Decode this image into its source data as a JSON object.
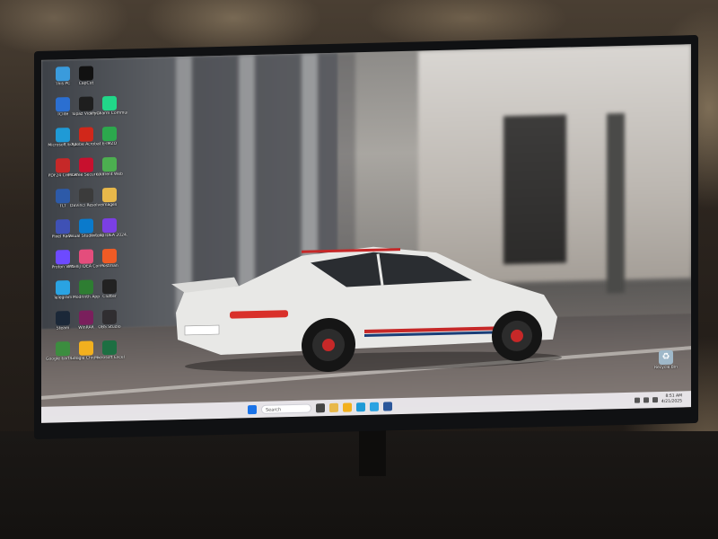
{
  "desktop": {
    "icons": [
      {
        "label": "This PC",
        "icon": "computer-icon",
        "color": "#3a9bdc"
      },
      {
        "label": "CapCut",
        "icon": "capcut-icon",
        "color": "#111111"
      },
      {
        "label": "TClite",
        "icon": "tclite-icon",
        "color": "#2b6fd1"
      },
      {
        "label": "Topaz Video AI",
        "icon": "topaz-icon",
        "color": "#1e1e1e"
      },
      {
        "label": "PyCharm Commun...",
        "icon": "pycharm-icon",
        "color": "#21d789"
      },
      {
        "label": "Microsoft Edge",
        "icon": "edge-icon",
        "color": "#1f9ad6"
      },
      {
        "label": "Adobe Acrobat",
        "icon": "acrobat-icon",
        "color": "#d1271a"
      },
      {
        "label": "E-IMZO",
        "icon": "eimzo-icon",
        "color": "#2ca84d"
      },
      {
        "label": "PDF24 Creator",
        "icon": "pdf24-icon",
        "color": "#c62828"
      },
      {
        "label": "McAfee Security Sc...",
        "icon": "mcafee-icon",
        "color": "#c8102e"
      },
      {
        "label": "uTorrent Web",
        "icon": "utorrent-icon",
        "color": "#4caf50"
      },
      {
        "label": "TLT",
        "icon": "tlt-icon",
        "color": "#2d5aa8"
      },
      {
        "label": "DaVinci Resolve",
        "icon": "davinci-icon",
        "color": "#3b3b3b"
      },
      {
        "label": "images",
        "icon": "folder-icon",
        "color": "#e8b84a"
      },
      {
        "label": "Pixel Radio",
        "icon": "radio-icon",
        "color": "#3f51b5"
      },
      {
        "label": "Visual Studio Code",
        "icon": "vscode-icon",
        "color": "#0a7acc"
      },
      {
        "label": "IntelliJ IDEA 2024.3.4.1",
        "icon": "intellij-icon",
        "color": "#7b3fe4"
      },
      {
        "label": "Proton VPN",
        "icon": "proton-icon",
        "color": "#6d4aff"
      },
      {
        "label": "IntelliJ IDEA Commun...",
        "icon": "intellij-community-icon",
        "color": "#e44d7c"
      },
      {
        "label": "Postman",
        "icon": "postman-icon",
        "color": "#ef5b25"
      },
      {
        "label": "Telegram",
        "icon": "telegram-icon",
        "color": "#2aa3e2"
      },
      {
        "label": "Modrinth App",
        "icon": "modrinth-icon",
        "color": "#2e7d32"
      },
      {
        "label": "Clutter",
        "icon": "clutter-icon",
        "color": "#222222"
      },
      {
        "label": "Steam",
        "icon": "steam-icon",
        "color": "#1b2838"
      },
      {
        "label": "WinRAR",
        "icon": "winrar-icon",
        "color": "#7a1f5c"
      },
      {
        "label": "OBS Studio",
        "icon": "obs-icon",
        "color": "#302e31"
      },
      {
        "label": "Google Earth Pro",
        "icon": "earth-icon",
        "color": "#3c8d3f"
      },
      {
        "label": "Google Chrome",
        "icon": "chrome-icon",
        "color": "#f2b01e"
      },
      {
        "label": "Microsoft Excel",
        "icon": "excel-icon",
        "color": "#1d6f42"
      }
    ],
    "recycle_bin": {
      "label": "Recycle Bin",
      "icon": "recycle-bin-icon"
    }
  },
  "taskbar": {
    "search_placeholder": "Search",
    "pinned": [
      {
        "icon": "windows-start-icon",
        "color": "#1a73e8"
      },
      {
        "icon": "task-view-icon",
        "color": "#444444"
      },
      {
        "icon": "file-explorer-icon",
        "color": "#e8b84a"
      },
      {
        "icon": "chrome-taskbar-icon",
        "color": "#f2b01e"
      },
      {
        "icon": "edge-taskbar-icon",
        "color": "#1f9ad6"
      },
      {
        "icon": "telegram-taskbar-icon",
        "color": "#2aa3e2"
      },
      {
        "icon": "word-taskbar-icon",
        "color": "#2b579a"
      }
    ],
    "clock_time": "8:51 AM",
    "clock_date": "4/21/2025"
  }
}
